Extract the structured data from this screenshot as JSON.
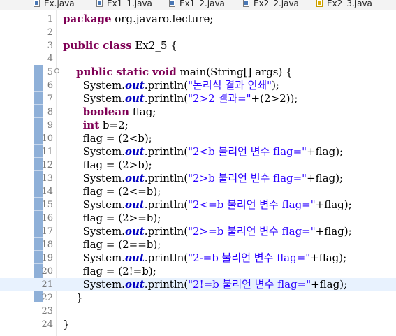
{
  "tabs": [
    {
      "label": "Ex.java",
      "icon": "java-file-icon"
    },
    {
      "label": "Ex1_1.java",
      "icon": "java-file-icon"
    },
    {
      "label": "Ex1_2.java",
      "icon": "java-file-icon"
    },
    {
      "label": "Ex2_2.java",
      "icon": "java-file-icon"
    },
    {
      "label": "Ex2_3.java",
      "icon": "java-warning-file-icon"
    }
  ],
  "lines": [
    {
      "num": "1",
      "parts": [
        [
          "kw",
          "package"
        ],
        [
          "t",
          " org.javaro.lecture;"
        ]
      ]
    },
    {
      "num": "2",
      "parts": []
    },
    {
      "num": "3",
      "parts": [
        [
          "kw",
          "public"
        ],
        [
          "t",
          " "
        ],
        [
          "kw",
          "class"
        ],
        [
          "t",
          " Ex2_5 {"
        ]
      ]
    },
    {
      "num": "4",
      "parts": []
    },
    {
      "num": "5",
      "fold": true,
      "parts": [
        [
          "t",
          "    "
        ],
        [
          "kw",
          "public"
        ],
        [
          "t",
          " "
        ],
        [
          "kw",
          "static"
        ],
        [
          "t",
          " "
        ],
        [
          "kw",
          "void"
        ],
        [
          "t",
          " main(String[] args) {"
        ]
      ]
    },
    {
      "num": "6",
      "parts": [
        [
          "t",
          "      System."
        ],
        [
          "fld",
          "out"
        ],
        [
          "t",
          ".println("
        ],
        [
          "str",
          "\"논리식 결과 인쇄\""
        ],
        [
          "t",
          ");"
        ]
      ]
    },
    {
      "num": "7",
      "parts": [
        [
          "t",
          "      System."
        ],
        [
          "fld",
          "out"
        ],
        [
          "t",
          ".println("
        ],
        [
          "str",
          "\"2>2 결과=\""
        ],
        [
          "t",
          "+(2>2));"
        ]
      ]
    },
    {
      "num": "8",
      "parts": [
        [
          "t",
          "      "
        ],
        [
          "kw",
          "boolean"
        ],
        [
          "t",
          " flag;"
        ]
      ]
    },
    {
      "num": "9",
      "parts": [
        [
          "t",
          "      "
        ],
        [
          "kw",
          "int"
        ],
        [
          "t",
          " b=2;"
        ]
      ]
    },
    {
      "num": "10",
      "parts": [
        [
          "t",
          "      flag = (2<b);"
        ]
      ]
    },
    {
      "num": "11",
      "parts": [
        [
          "t",
          "      System."
        ],
        [
          "fld",
          "out"
        ],
        [
          "t",
          ".println("
        ],
        [
          "str",
          "\"2<b 불리언 변수 flag=\""
        ],
        [
          "t",
          "+flag);"
        ]
      ]
    },
    {
      "num": "12",
      "parts": [
        [
          "t",
          "      flag = (2>b);"
        ]
      ]
    },
    {
      "num": "13",
      "parts": [
        [
          "t",
          "      System."
        ],
        [
          "fld",
          "out"
        ],
        [
          "t",
          ".println("
        ],
        [
          "str",
          "\"2>b 불리언 변수 flag=\""
        ],
        [
          "t",
          "+flag);"
        ]
      ]
    },
    {
      "num": "14",
      "parts": [
        [
          "t",
          "      flag = (2<=b);"
        ]
      ]
    },
    {
      "num": "15",
      "parts": [
        [
          "t",
          "      System."
        ],
        [
          "fld",
          "out"
        ],
        [
          "t",
          ".println("
        ],
        [
          "str",
          "\"2<=b 불리언 변수 flag=\""
        ],
        [
          "t",
          "+flag);"
        ]
      ]
    },
    {
      "num": "16",
      "parts": [
        [
          "t",
          "      flag = (2>=b);"
        ]
      ]
    },
    {
      "num": "17",
      "parts": [
        [
          "t",
          "      System."
        ],
        [
          "fld",
          "out"
        ],
        [
          "t",
          ".println("
        ],
        [
          "str",
          "\"2>=b 불리언 변수 flag=\""
        ],
        [
          "t",
          "+flag);"
        ]
      ]
    },
    {
      "num": "18",
      "parts": [
        [
          "t",
          "      flag = (2==b);"
        ]
      ]
    },
    {
      "num": "19",
      "parts": [
        [
          "t",
          "      System."
        ],
        [
          "fld",
          "out"
        ],
        [
          "t",
          ".println("
        ],
        [
          "str",
          "\"2-=b 불리언 변수 flag=\""
        ],
        [
          "t",
          "+flag);"
        ]
      ]
    },
    {
      "num": "20",
      "parts": [
        [
          "t",
          "      flag = (2!=b);"
        ]
      ]
    },
    {
      "num": "21",
      "current": true,
      "parts": [
        [
          "t",
          "      System."
        ],
        [
          "fld",
          "out"
        ],
        [
          "t",
          ".println("
        ],
        [
          "str",
          "\"2!=b 불리언 변수 flag=\""
        ],
        [
          "t",
          "+flag);"
        ]
      ]
    },
    {
      "num": "22",
      "parts": [
        [
          "t",
          "    }"
        ]
      ]
    },
    {
      "num": "23",
      "parts": []
    },
    {
      "num": "24",
      "parts": [
        [
          "t",
          "}"
        ]
      ]
    }
  ]
}
